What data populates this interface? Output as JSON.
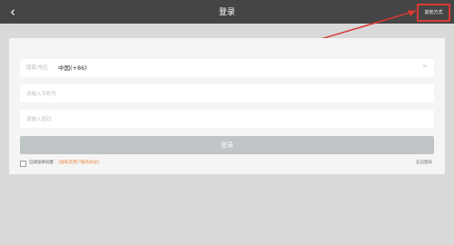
{
  "topbar": {
    "title": "登录",
    "back_icon": "chevron-left-icon",
    "other_methods_label": "其他方式"
  },
  "form": {
    "region": {
      "label": "国家/地区",
      "value": "中国(+86)",
      "icon": "chevron-right-icon"
    },
    "phone": {
      "placeholder": "请输入手机号"
    },
    "password": {
      "placeholder": "请输入密码"
    },
    "login_label": "登录",
    "agree_text": "已阅读并同意",
    "terms_link": "《隐私及用户服务协议》",
    "forgot_label": "忘记密码"
  },
  "colors": {
    "topbar_bg": "#454545",
    "highlight": "#d83a34",
    "link": "#e8823a",
    "button_disabled": "#bfc4c6"
  }
}
